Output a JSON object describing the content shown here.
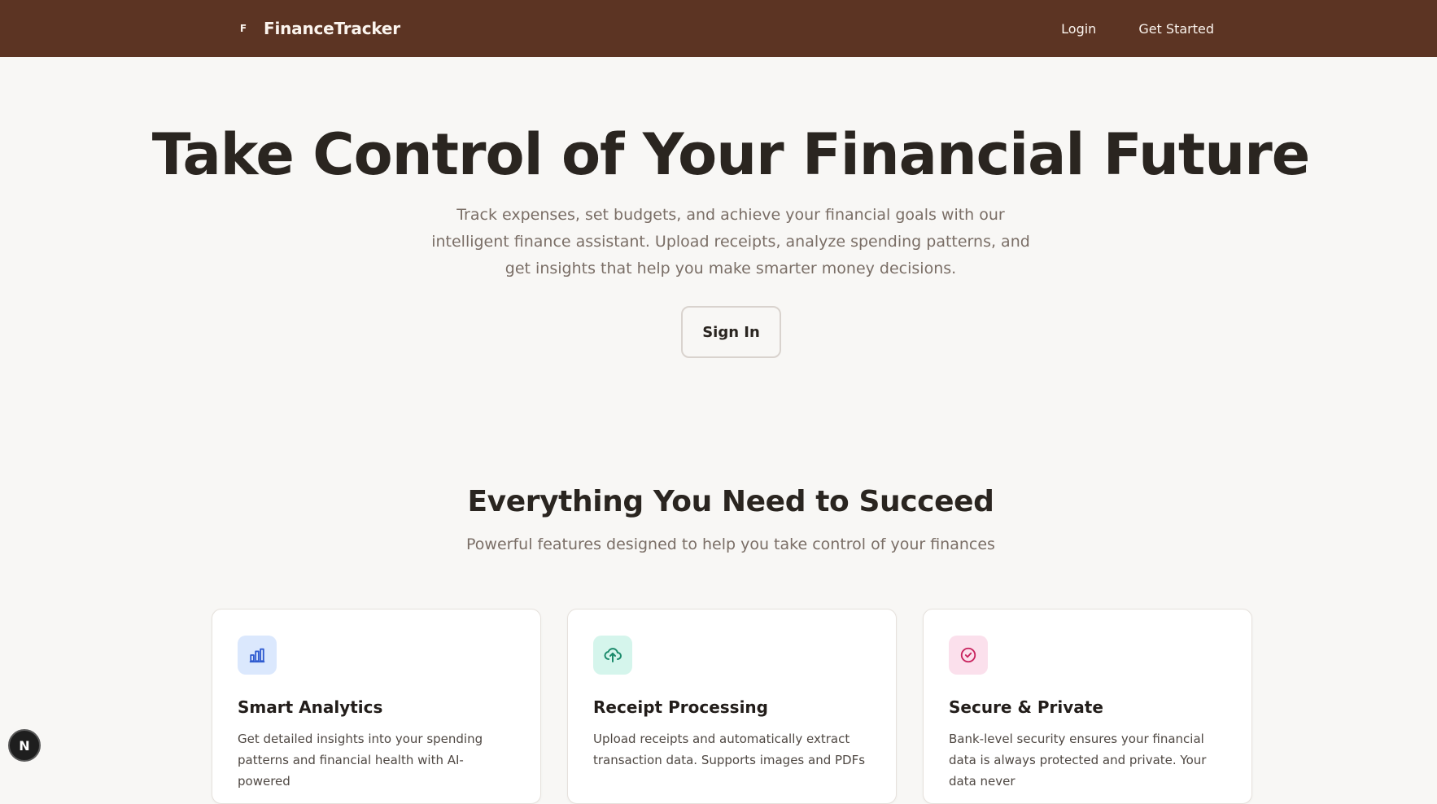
{
  "nav": {
    "brand_badge": "F",
    "brand_name": "FinanceTracker",
    "login": "Login",
    "get_started": "Get Started"
  },
  "hero": {
    "title": "Take Control of Your Financial Future",
    "subtitle": "Track expenses, set budgets, and achieve your financial goals with our intelligent finance assistant. Upload receipts, analyze spending patterns, and get insights that help you make smarter money decisions.",
    "cta": "Sign In"
  },
  "features": {
    "title": "Everything You Need to Succeed",
    "subtitle": "Powerful features designed to help you take control of your finances",
    "cards": [
      {
        "icon": "bar-chart-icon",
        "title": "Smart Analytics",
        "text": "Get detailed insights into your spending patterns and financial health with AI-powered",
        "icon_bg": "#dbe8fd",
        "icon_color": "#2f5bd0"
      },
      {
        "icon": "cloud-upload-icon",
        "title": "Receipt Processing",
        "text": "Upload receipts and automatically extract transaction data. Supports images and PDFs",
        "icon_bg": "#d5f5ec",
        "icon_color": "#1b8a6b"
      },
      {
        "icon": "check-circle-icon",
        "title": "Secure & Private",
        "text": "Bank-level security ensures your financial data is always protected and private. Your data never",
        "icon_bg": "#fbe0ec",
        "icon_color": "#c8235e"
      }
    ]
  },
  "devtools": {
    "label": "N"
  }
}
